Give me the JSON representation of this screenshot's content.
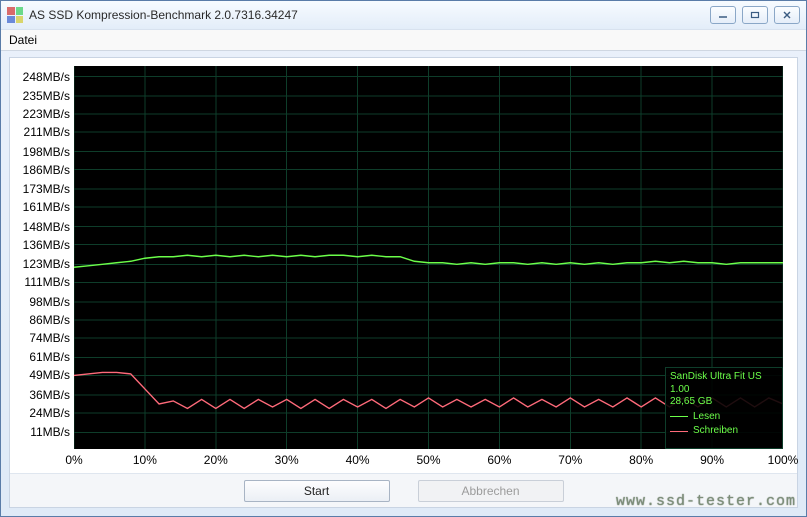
{
  "window": {
    "title": "AS SSD Kompression-Benchmark 2.0.7316.34247"
  },
  "menubar": {
    "file": "Datei"
  },
  "buttons": {
    "start": "Start",
    "cancel": "Abbrechen"
  },
  "legend": {
    "device": "SanDisk Ultra Fit US",
    "firmware": "1.00",
    "capacity": "28,65 GB",
    "read": "Lesen",
    "write": "Schreiben"
  },
  "watermark": "www.ssd-tester.com",
  "chart_data": {
    "type": "line",
    "xlabel": "",
    "ylabel": "",
    "xlim": [
      0,
      100
    ],
    "ylim": [
      0,
      255
    ],
    "x_tick_labels": [
      "0%",
      "10%",
      "20%",
      "30%",
      "40%",
      "50%",
      "60%",
      "70%",
      "80%",
      "90%",
      "100%"
    ],
    "y_tick_values": [
      11,
      24,
      36,
      49,
      61,
      74,
      86,
      98,
      111,
      123,
      136,
      148,
      161,
      173,
      186,
      198,
      211,
      223,
      235,
      248
    ],
    "y_tick_labels": [
      "11MB/s",
      "24MB/s",
      "36MB/s",
      "49MB/s",
      "61MB/s",
      "74MB/s",
      "86MB/s",
      "98MB/s",
      "111MB/s",
      "123MB/s",
      "136MB/s",
      "148MB/s",
      "161MB/s",
      "173MB/s",
      "186MB/s",
      "198MB/s",
      "211MB/s",
      "223MB/s",
      "235MB/s",
      "248MB/s"
    ],
    "x": [
      0,
      2,
      4,
      6,
      8,
      10,
      12,
      14,
      16,
      18,
      20,
      22,
      24,
      26,
      28,
      30,
      32,
      34,
      36,
      38,
      40,
      42,
      44,
      46,
      48,
      50,
      52,
      54,
      56,
      58,
      60,
      62,
      64,
      66,
      68,
      70,
      72,
      74,
      76,
      78,
      80,
      82,
      84,
      86,
      88,
      90,
      92,
      94,
      96,
      98,
      100
    ],
    "series": [
      {
        "name": "Lesen",
        "color": "#6cff4a",
        "values": [
          121,
          122,
          123,
          124,
          125,
          127,
          128,
          128,
          129,
          128,
          129,
          128,
          129,
          128,
          129,
          128,
          129,
          128,
          129,
          129,
          128,
          129,
          128,
          128,
          125,
          124,
          124,
          123,
          124,
          123,
          124,
          124,
          123,
          124,
          123,
          124,
          123,
          124,
          123,
          124,
          124,
          125,
          124,
          125,
          124,
          124,
          123,
          124,
          124,
          124,
          124
        ]
      },
      {
        "name": "Schreiben",
        "color": "#ff6a7a",
        "values": [
          49,
          50,
          51,
          51,
          50,
          40,
          30,
          32,
          27,
          33,
          27,
          33,
          27,
          33,
          28,
          33,
          27,
          33,
          27,
          33,
          28,
          33,
          27,
          33,
          28,
          34,
          28,
          33,
          28,
          33,
          28,
          34,
          28,
          33,
          28,
          34,
          28,
          33,
          28,
          34,
          28,
          34,
          28,
          34,
          28,
          34,
          28,
          34,
          28,
          34,
          30
        ]
      }
    ]
  }
}
